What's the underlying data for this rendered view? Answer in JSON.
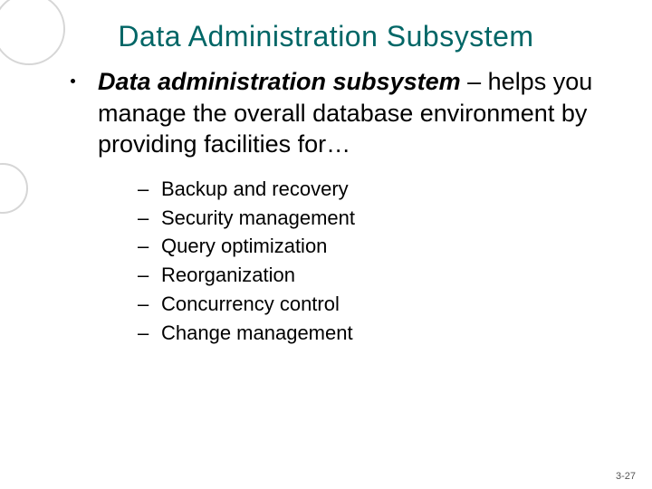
{
  "title": "Data Administration Subsystem",
  "main": {
    "term": "Data administration subsystem",
    "sep": " – ",
    "body": "helps you manage the overall database environment by providing facilities for…"
  },
  "sub_items": [
    "Backup and recovery",
    "Security management",
    "Query optimization",
    "Reorganization",
    "Concurrency control",
    "Change management"
  ],
  "page_number": "3-27"
}
